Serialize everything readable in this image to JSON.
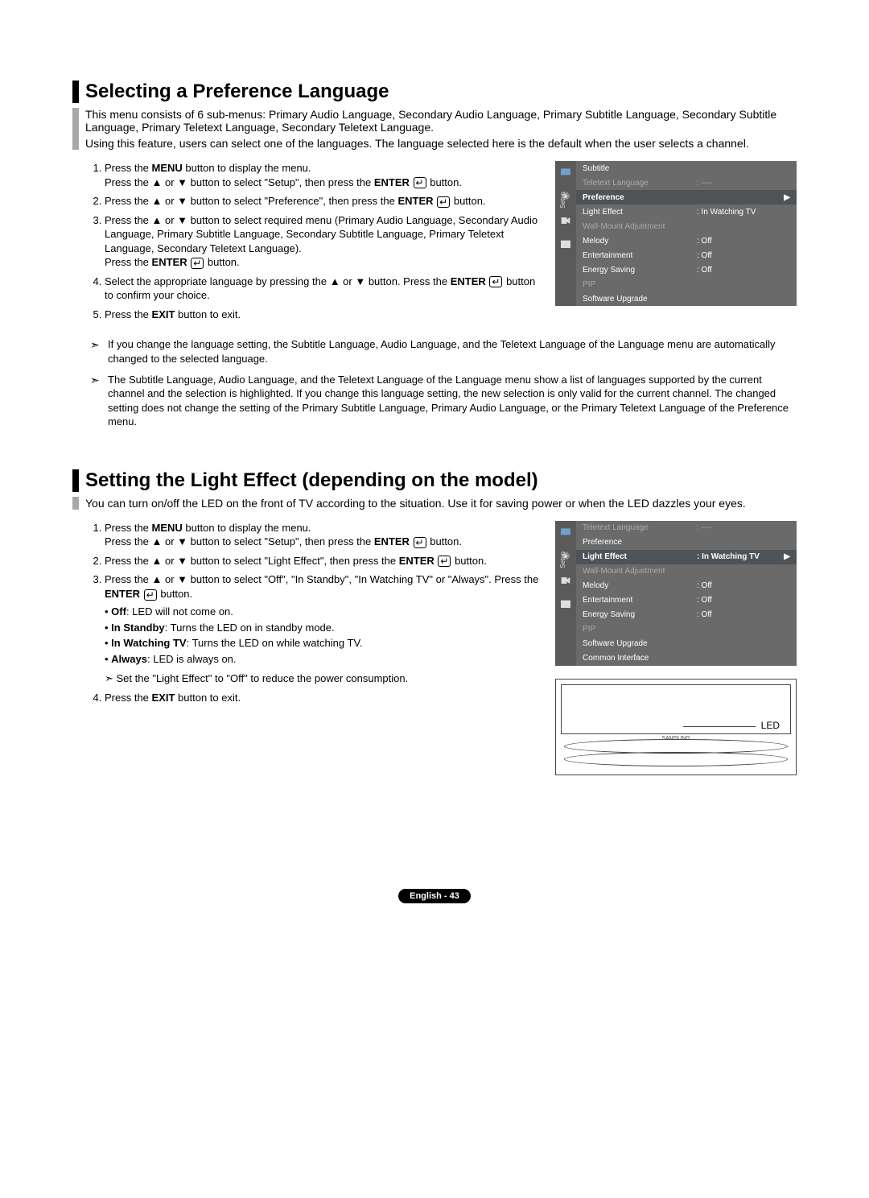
{
  "section1": {
    "heading": "Selecting a Preference Language",
    "intro_p1": "This menu consists of 6 sub-menus: Primary Audio Language, Secondary Audio Language, Primary Subtitle Language, Secondary Subtitle Language, Primary Teletext Language, Secondary Teletext Language.",
    "intro_p2": "Using this feature, users can select one of the languages. The language selected here is the default when the user selects a channel.",
    "steps": {
      "s1a_pre": "Press the ",
      "s1a_bold": "MENU",
      "s1a_post": " button to display the menu.",
      "s1b_pre": "Press the ▲ or ▼ button to select \"Setup\", then press the ",
      "s1b_bold": "ENTER",
      "s1b_post": " button.",
      "s2_pre": "Press the ▲ or ▼ button to select \"Preference\", then press the ",
      "s2_bold": "ENTER",
      "s2_post": " button.",
      "s3a": "Press the ▲ or ▼ button to select required menu (Primary Audio Language, Secondary Audio Language, Primary Subtitle Language, Secondary Subtitle Language, Primary Teletext Language, Secondary Teletext Language).",
      "s3b_pre": "Press the ",
      "s3b_bold": "ENTER",
      "s3b_post": " button.",
      "s4_pre": "Select the appropriate language by pressing the ▲ or ▼ button. Press the ",
      "s4_bold": "ENTER",
      "s4_post": " button to confirm your choice.",
      "s5_pre": "Press the ",
      "s5_bold": "EXIT",
      "s5_post": " button to exit."
    },
    "notes": {
      "n1": "If you change the language setting, the Subtitle Language, Audio Language, and the Teletext Language of the Language menu are automatically changed to the selected language.",
      "n2": "The Subtitle Language, Audio Language, and the Teletext Language of the Language menu show a list of languages supported by the current channel and the selection is highlighted. If you change this language setting, the new selection is only valid for the current channel. The changed setting does not change the setting of the Primary Subtitle Language, Primary Audio Language, or the Primary Teletext Language of the Preference menu."
    }
  },
  "osd1": {
    "side_label": "Setup",
    "rows": [
      {
        "label": "Subtitle",
        "val": "",
        "dim": false,
        "hl": false
      },
      {
        "label": "Teletext Language",
        "val": ": ----",
        "dim": true,
        "hl": false
      },
      {
        "label": "Preference",
        "val": "",
        "dim": false,
        "hl": true,
        "chev": "▶"
      },
      {
        "label": "Light Effect",
        "val": ": In Watching TV",
        "dim": false,
        "hl": false
      },
      {
        "label": "Wall-Mount Adjustment",
        "val": "",
        "dim": true,
        "hl": false
      },
      {
        "label": "Melody",
        "val": ": Off",
        "dim": false,
        "hl": false
      },
      {
        "label": "Entertainment",
        "val": ": Off",
        "dim": false,
        "hl": false
      },
      {
        "label": "Energy Saving",
        "val": ": Off",
        "dim": false,
        "hl": false
      },
      {
        "label": "PIP",
        "val": "",
        "dim": true,
        "hl": false
      },
      {
        "label": "Software Upgrade",
        "val": "",
        "dim": false,
        "hl": false
      }
    ]
  },
  "section2": {
    "heading": "Setting the Light Effect (depending on the model)",
    "intro": "You can turn on/off the LED on the front of TV according to the situation. Use it for saving power or when the LED dazzles your eyes.",
    "steps": {
      "s1a_pre": "Press the ",
      "s1a_bold": "MENU",
      "s1a_post": " button to display the menu.",
      "s1b_pre": "Press the ▲ or ▼ button to select \"Setup\", then press the ",
      "s1b_bold": "ENTER",
      "s1b_post": " button.",
      "s2_pre": "Press the ▲ or ▼ button to select \"Light Effect\", then press the ",
      "s2_bold": "ENTER",
      "s2_post": " button.",
      "s3_pre": "Press the ▲ or ▼ button to select \"Off\", \"In Standby\", \"In Watching TV\" or \"Always\". Press the ",
      "s3_bold": "ENTER",
      "s3_post": " button.",
      "b1_bold": "Off",
      "b1_rest": ": LED will not come on.",
      "b2_bold": "In Standby",
      "b2_rest": ": Turns the LED on in standby mode.",
      "b3_bold": "In Watching TV",
      "b3_rest": ": Turns the LED on while watching TV.",
      "b4_bold": "Always",
      "b4_rest": ": LED is always on.",
      "note": "Set the \"Light Effect\" to \"Off\" to reduce the power consumption.",
      "s4_pre": "Press the ",
      "s4_bold": "EXIT",
      "s4_post": " button to exit."
    }
  },
  "osd2": {
    "side_label": "Setup",
    "rows": [
      {
        "label": "Teletext Language",
        "val": ": ----",
        "dim": true,
        "hl": false
      },
      {
        "label": "Preference",
        "val": "",
        "dim": false,
        "hl": false
      },
      {
        "label": "Light Effect",
        "val": ": In Watching TV",
        "dim": false,
        "hl": true,
        "chev": "▶"
      },
      {
        "label": "Wall-Mount Adjustment",
        "val": "",
        "dim": true,
        "hl": false
      },
      {
        "label": "Melody",
        "val": ": Off",
        "dim": false,
        "hl": false
      },
      {
        "label": "Entertainment",
        "val": ": Off",
        "dim": false,
        "hl": false
      },
      {
        "label": "Energy Saving",
        "val": ": Off",
        "dim": false,
        "hl": false
      },
      {
        "label": "PIP",
        "val": "",
        "dim": true,
        "hl": false
      },
      {
        "label": "Software Upgrade",
        "val": "",
        "dim": false,
        "hl": false
      },
      {
        "label": "Common Interface",
        "val": "",
        "dim": false,
        "hl": false
      }
    ]
  },
  "tv": {
    "led_label": "LED",
    "brand": "SAMSUNG"
  },
  "footer": "English - 43",
  "enter_glyph": "↵"
}
